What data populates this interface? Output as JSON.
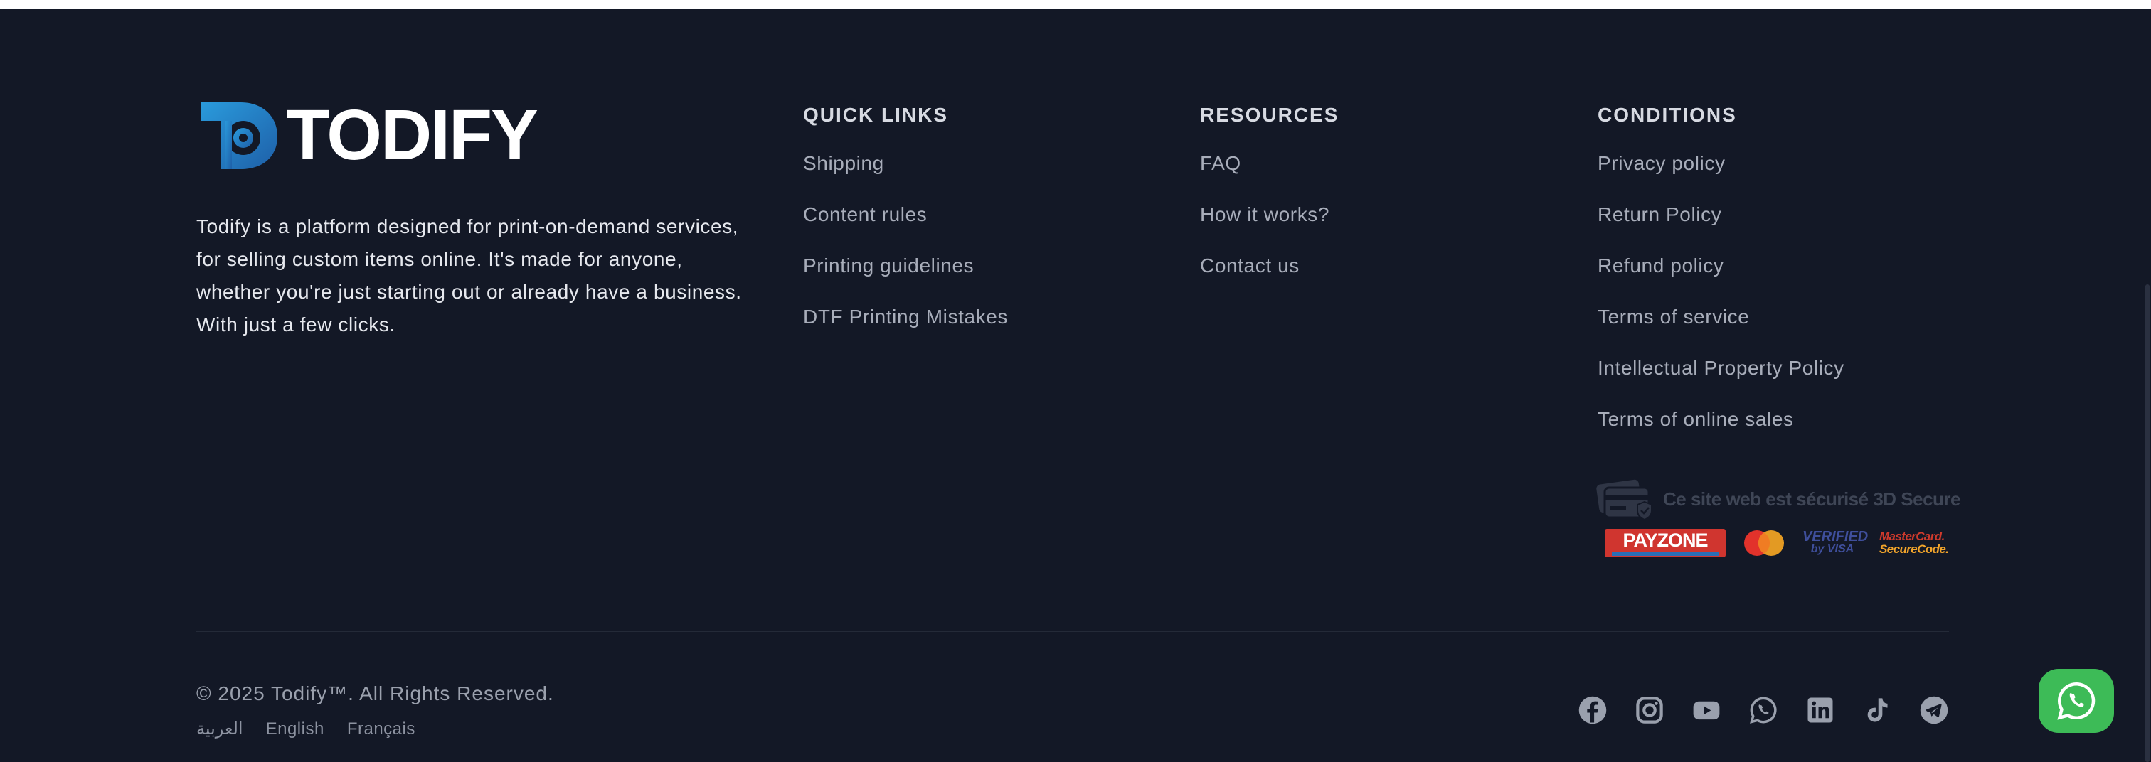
{
  "brand": {
    "name": "TODIFY",
    "description": "Todify is a platform designed for print-on-demand services, for selling custom items online. It's made for anyone, whether you're just starting out or already have a business. With just a few clicks.",
    "colors": {
      "logo_gradient_start": "#2a8fd0",
      "logo_gradient_end": "#1d5f9e",
      "text": "#ffffff"
    }
  },
  "quick_links": {
    "title": "QUICK LINKS",
    "items": [
      "Shipping",
      "Content rules",
      "Printing guidelines",
      "DTF Printing Mistakes"
    ]
  },
  "resources": {
    "title": "RESOURCES",
    "items": [
      "FAQ",
      "How it works?",
      "Contact us"
    ]
  },
  "conditions": {
    "title": "CONDITIONS",
    "items": [
      "Privacy policy",
      "Return Policy",
      "Refund policy",
      "Terms of service",
      "Intellectual Property Policy",
      "Terms of online sales"
    ]
  },
  "secure": {
    "text": "Ce site web est sécurisé 3D Secure",
    "payzone": "PAYZONE",
    "verified_line1": "VERIFIED",
    "verified_line2": "by VISA",
    "mc_line1": "MasterCard.",
    "mc_line2": "SecureCode."
  },
  "bottom": {
    "copyright": "© 2025 Todify™. All Rights Reserved.",
    "languages": [
      "العربية",
      "English",
      "Français"
    ]
  },
  "socials": [
    "facebook-icon",
    "instagram-icon",
    "youtube-icon",
    "whatsapp-icon",
    "linkedin-icon",
    "tiktok-icon",
    "telegram-icon"
  ],
  "colors": {
    "background": "#131826",
    "link": "#a8adba",
    "heading": "#d7dae2",
    "whatsapp": "#3dbb57"
  }
}
